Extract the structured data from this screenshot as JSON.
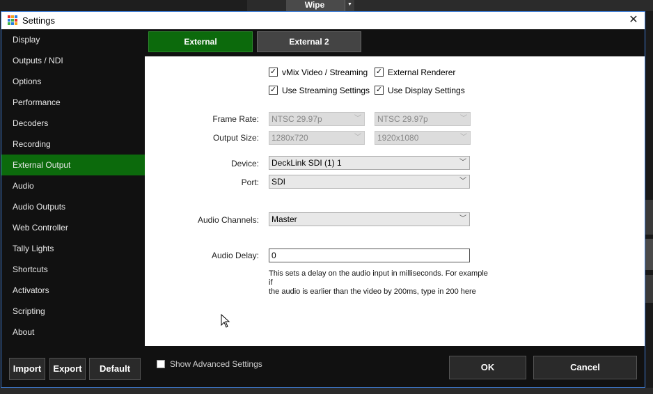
{
  "background_app": {
    "transition_label": "Wipe"
  },
  "window": {
    "title": "Settings"
  },
  "sidebar": {
    "items": [
      {
        "label": "Display"
      },
      {
        "label": "Outputs / NDI"
      },
      {
        "label": "Options"
      },
      {
        "label": "Performance"
      },
      {
        "label": "Decoders"
      },
      {
        "label": "Recording"
      },
      {
        "label": "External Output",
        "active": true
      },
      {
        "label": "Audio"
      },
      {
        "label": "Audio Outputs"
      },
      {
        "label": "Web Controller"
      },
      {
        "label": "Tally Lights"
      },
      {
        "label": "Shortcuts"
      },
      {
        "label": "Activators"
      },
      {
        "label": "Scripting"
      },
      {
        "label": "About"
      }
    ]
  },
  "tabs": [
    {
      "label": "External",
      "active": true
    },
    {
      "label": "External 2",
      "active": false
    }
  ],
  "form": {
    "vmix_video_streaming": {
      "label": "vMix Video / Streaming",
      "checked": true
    },
    "external_renderer": {
      "label": "External Renderer",
      "checked": true
    },
    "use_streaming_settings": {
      "label": "Use Streaming Settings",
      "checked": true
    },
    "use_display_settings": {
      "label": "Use Display Settings",
      "checked": true
    },
    "frame_rate": {
      "label": "Frame Rate:",
      "value1": "NTSC 29.97p",
      "value2": "NTSC 29.97p"
    },
    "output_size": {
      "label": "Output Size:",
      "value1": "1280x720",
      "value2": "1920x1080"
    },
    "device": {
      "label": "Device:",
      "value": "DeckLink SDI (1) 1"
    },
    "port": {
      "label": "Port:",
      "value": "SDI"
    },
    "audio_channels": {
      "label": "Audio Channels:",
      "value": "Master"
    },
    "audio_delay": {
      "label": "Audio Delay:",
      "value": "0",
      "hint_line1": "This sets a delay on the audio input in milliseconds. For example if",
      "hint_line2": "the audio is earlier than the video by 200ms, type in 200 here"
    }
  },
  "footer": {
    "import_label": "Import",
    "export_label": "Export",
    "default_label": "Default",
    "show_advanced": {
      "label": "Show Advanced Settings",
      "checked": false
    },
    "ok_label": "OK",
    "cancel_label": "Cancel"
  },
  "colors": {
    "accent_green": "#0c6a0c",
    "title_border": "#3d7ad0"
  },
  "icons": {
    "close": "close-icon",
    "dropdown": "chevron-down-icon",
    "app": "vmix-logo-icon",
    "check": "checkmark-icon"
  }
}
